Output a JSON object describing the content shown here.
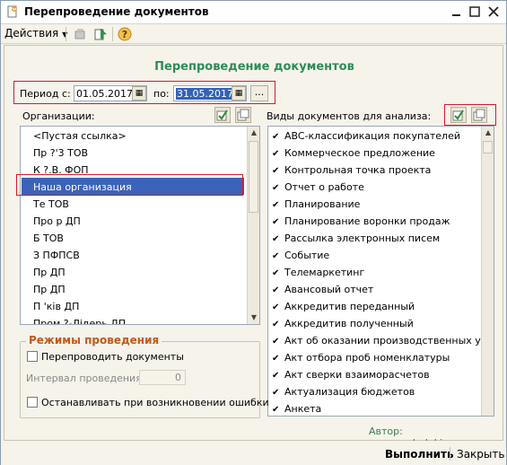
{
  "window": {
    "title": "Перепроведение документов",
    "controls": [
      "minimize-icon",
      "maximize-icon",
      "close-icon"
    ]
  },
  "toolbar": {
    "actions_label": "Действия",
    "icons": [
      "back-icon",
      "export-icon",
      "help-icon"
    ]
  },
  "form": {
    "title": "Перепроведение документов",
    "period": {
      "label": "Период с:",
      "from": "01.05.2017",
      "to_label": "по:",
      "to": "31.05.2017",
      "more": "..."
    },
    "organizations": {
      "label": "Организации:",
      "items": [
        "<Пустая ссылка>",
        "Пр     ?'3 ТОВ",
        "К          ?.В. ФОП",
        "Наша организация",
        "Те               ТОВ",
        "Про          р ДП",
        "Б     ТОВ",
        "З          ПФПСВ",
        "Пр         ДП",
        "Пр           ДП",
        "П         'ків ДП",
        "Пром  ?-Лiдерь ДП"
      ],
      "selected_index": 3
    },
    "doc_types": {
      "label": "Виды документов для анализа:",
      "items": [
        "ABC-классификация покупателей",
        "Коммерческое предложение",
        "Контрольная точка проекта",
        "Отчет о работе",
        "Планирование",
        "Планирование воронки продаж",
        "Рассылка электронных писем",
        "Событие",
        "Телемаркетинг",
        "Авансовый отчет",
        "Аккредитив переданный",
        "Аккредитив полученный",
        "Акт об оказании производственных услуг",
        "Акт отбора проб номенклатуры",
        "Акт сверки взаиморасчетов",
        "Актуализация бюджетов",
        "Анкета"
      ]
    },
    "modes": {
      "title": "Режимы проведения",
      "repost_label": "Перепроводить документы",
      "interval_label": "Интервал проведения:",
      "interval_value": "0",
      "stop_label": "Останавливать при возникновении ошибки"
    },
    "author": "Автор: www.gashuk.kiev.ua"
  },
  "buttons": {
    "execute": "Выполнить",
    "close": "Закрыть"
  }
}
